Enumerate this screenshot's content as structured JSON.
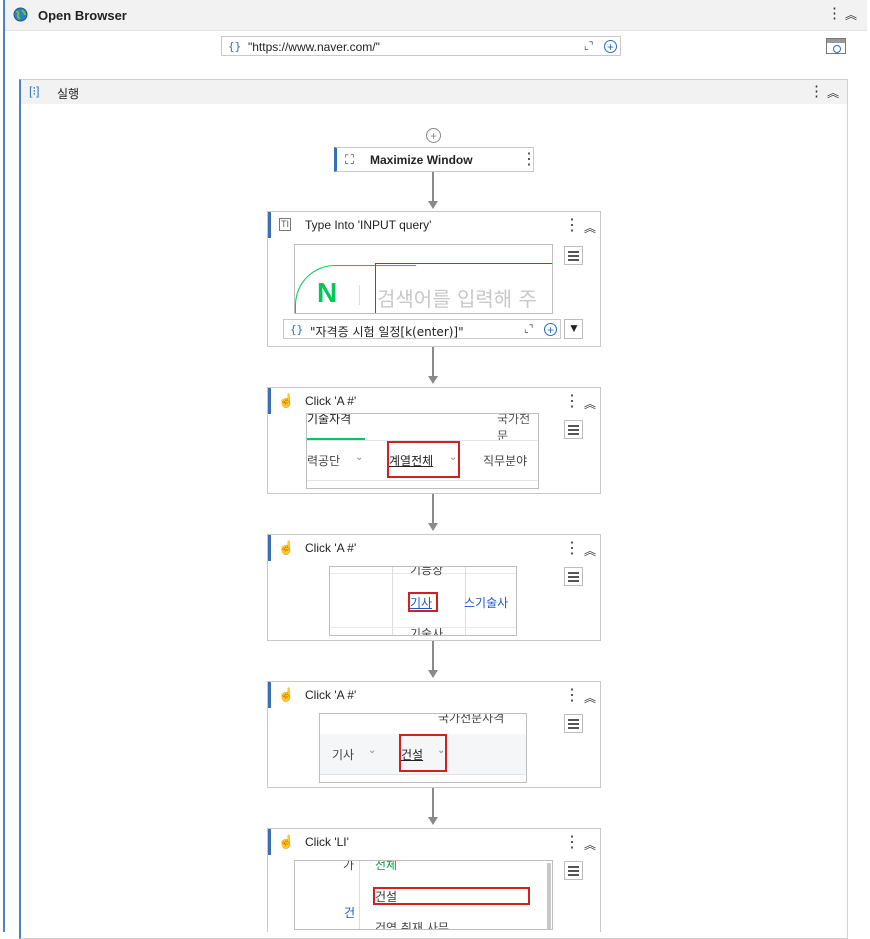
{
  "open_browser": {
    "title": "Open Browser",
    "url_value": "\"https://www.naver.com/\""
  },
  "sequence": {
    "title": "실행"
  },
  "activities": {
    "maximize": {
      "label": "Maximize Window"
    },
    "type_into": {
      "label": "Type Into 'INPUT  query'",
      "thumb_logo": "N",
      "thumb_placeholder": "검색어를 입력해 주",
      "text_value": "\"자격증 시험 일정[k(enter)]\""
    },
    "click1": {
      "label": "Click 'A  #'",
      "thumb_top_left": "기술자격",
      "thumb_top_right": "국가전문",
      "thumb_left": "력공단",
      "thumb_target": "계열전체",
      "thumb_right": "직무분야"
    },
    "click2": {
      "label": "Click 'A  #'",
      "thumb_top": "기능장",
      "thumb_target": "기사",
      "thumb_right": "스기술사",
      "thumb_bottom": "기술사"
    },
    "click3": {
      "label": "Click 'A  #'",
      "thumb_top": "국가전문자격",
      "thumb_left": "기사",
      "thumb_target": "건설"
    },
    "click4": {
      "label": "Click 'LI'",
      "thumb_top_left": "가",
      "thumb_top": "전체",
      "thumb_target": "건설",
      "thumb_left": "건",
      "thumb_bottom": "건염 취재 사무"
    }
  },
  "colors": {
    "accent_blue": "#3a6fb3",
    "highlight_red": "#d21f1f",
    "naver_green": "#03c75a"
  }
}
